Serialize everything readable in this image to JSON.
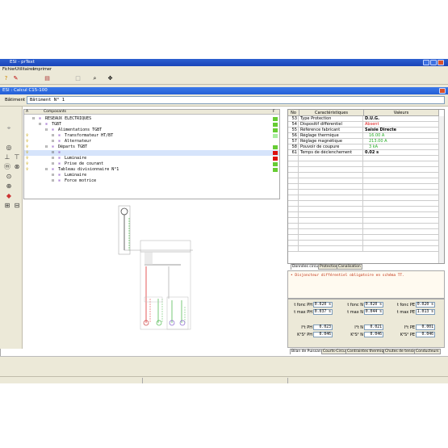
{
  "app": {
    "title": "ESI - prText",
    "menu": [
      "Fichier",
      "Utilitaires",
      "Imprimer"
    ]
  },
  "document": {
    "title": "ESI : Calcul C15-100",
    "batiment_label": "Bâtiment",
    "batiment_value": "Bâtiment N° 1"
  },
  "tree": {
    "header_a": "A",
    "header_components": "Composants",
    "header_f": "F",
    "rows": [
      {
        "text": "RESEAUX ELECTRIQUES",
        "indent": 0,
        "status": "g",
        "bulb": false
      },
      {
        "text": "TGBT",
        "indent": 1,
        "status": "g",
        "bulb": false
      },
      {
        "text": "Alimentations TGBT",
        "indent": 2,
        "status": "g",
        "bulb": false
      },
      {
        "text": "Transformateur HT/BT",
        "indent": 3,
        "status": "lg",
        "bulb": true
      },
      {
        "text": "Alternateur",
        "indent": 3,
        "status": "",
        "bulb": true
      },
      {
        "text": "Départs TGBT",
        "indent": 2,
        "status": "g",
        "bulb": true
      },
      {
        "text": "",
        "indent": 3,
        "status": "r",
        "bulb": true,
        "selected": true
      },
      {
        "text": "Luminaire",
        "indent": 3,
        "status": "r",
        "bulb": true
      },
      {
        "text": "Prise de courant",
        "indent": 3,
        "status": "g",
        "bulb": true
      },
      {
        "text": "Tableau divisionnaire N°1",
        "indent": 2,
        "status": "g",
        "bulb": true
      },
      {
        "text": "Luminaire",
        "indent": 3,
        "status": "",
        "bulb": false
      },
      {
        "text": "Force motrice",
        "indent": 3,
        "status": "",
        "bulb": false
      }
    ]
  },
  "table": {
    "col_no": "No",
    "col_char": "Caractéristiques",
    "col_val": "Valeurs",
    "rows": [
      {
        "no": "53",
        "label": "Type Protection",
        "value": "D.U.G.",
        "color": "#000"
      },
      {
        "no": "54",
        "label": "Dispositif différentiel",
        "value": "Absent",
        "color": "#dd1111"
      },
      {
        "no": "55",
        "label": "Référence fabricant",
        "value": "Saisie Directe",
        "color": "#000"
      },
      {
        "no": "56",
        "label": "Réglage thermique",
        "value": "16.00 A",
        "color": "#22aa22"
      },
      {
        "no": "57",
        "label": "Réglage magnétique",
        "value": "213.00 A",
        "color": "#22aa22"
      },
      {
        "no": "58",
        "label": "Pouvoir de coupure",
        "value": "3 kA",
        "color": "#22aa22"
      },
      {
        "no": "61",
        "label": "Temps de déclenchement",
        "value": "0.02 s",
        "color": "#000"
      }
    ],
    "empty_rows": 17
  },
  "tabs_top": [
    "Données circuit",
    "Protection",
    "Canalisation"
  ],
  "message": "• Disjoncteur différentiel obligatoire en schéma TT.",
  "results": {
    "row1": [
      {
        "label": "t fonc PH",
        "value": "0.020 s"
      },
      {
        "label": "t fonc N",
        "value": "0.020 s"
      },
      {
        "label": "t fonc PE",
        "value": "0.020 s"
      }
    ],
    "row2": [
      {
        "label": "t max PH",
        "value": "0.037 s"
      },
      {
        "label": "t max N",
        "value": "0.044 s"
      },
      {
        "label": "t max PE",
        "value": "1.013 s"
      }
    ],
    "row3": [
      {
        "label": "I²t PH",
        "value": "0.023"
      },
      {
        "label": "I²t N",
        "value": "0.021"
      },
      {
        "label": "I²t PE",
        "value": "0.001"
      }
    ],
    "row4": [
      {
        "label": "K²S² PH",
        "value": "0.046"
      },
      {
        "label": "K²S² N",
        "value": "0.046"
      },
      {
        "label": "K²S² PE",
        "value": "0.046"
      }
    ]
  },
  "tabs_bottom": [
    "Bilan de Puissance",
    "Courts-Circuits",
    "Contraintes thermiques",
    "Chutes de tension",
    "Conducteurs"
  ]
}
